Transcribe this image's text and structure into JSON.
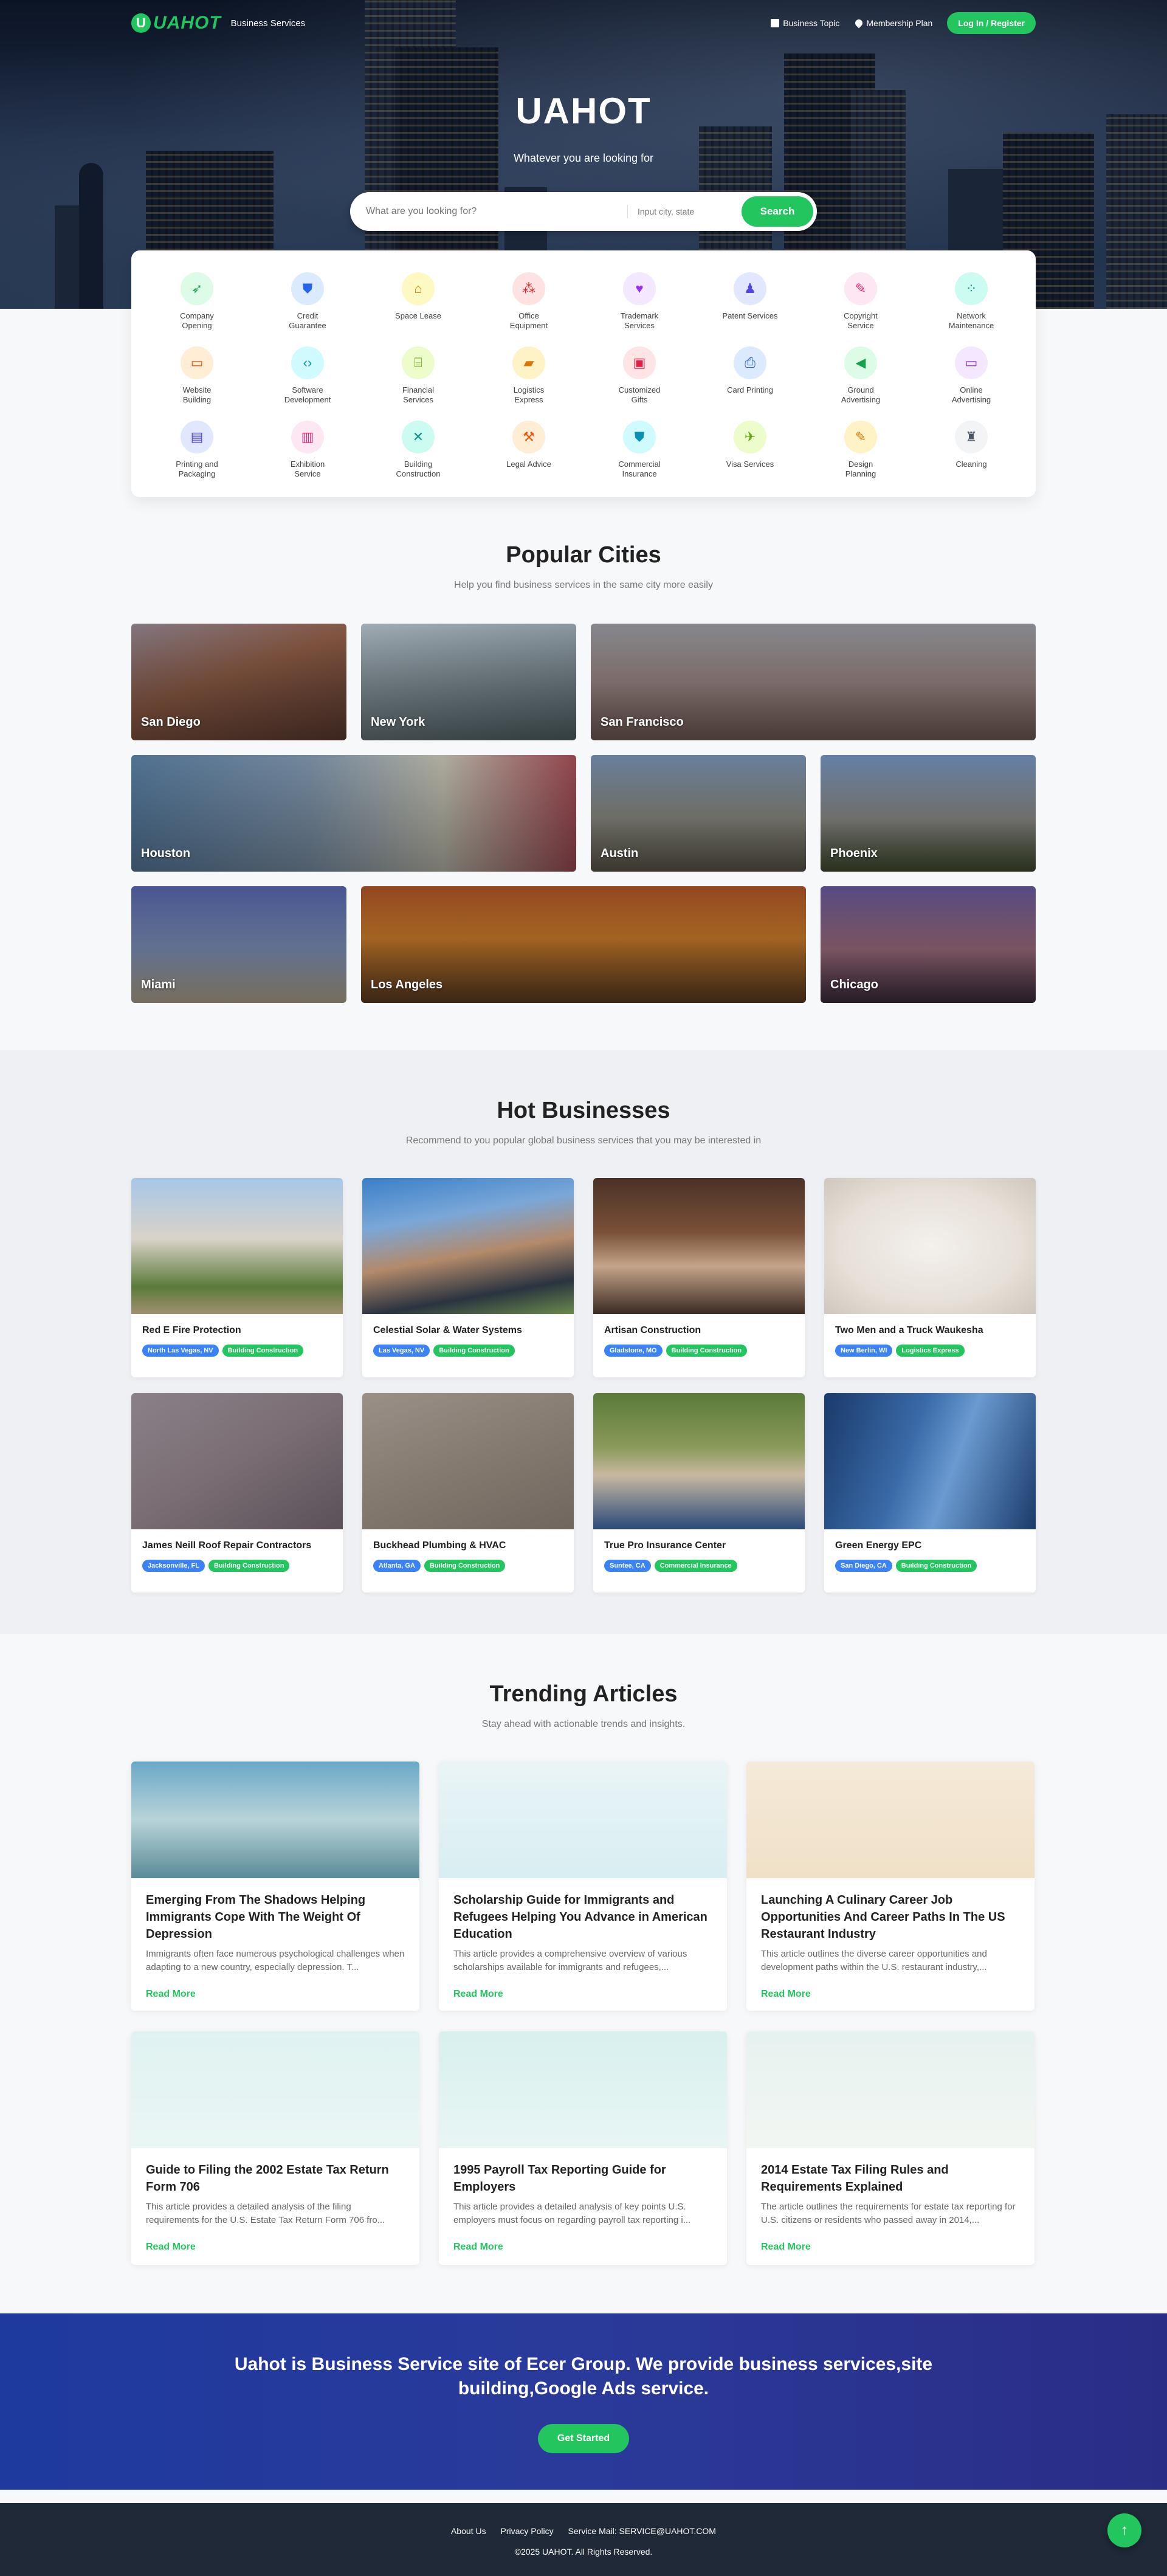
{
  "header": {
    "logo_letter": "U",
    "logo_text": "UAHOT",
    "logo_sub": "Business Services",
    "nav": [
      "Business Topic",
      "Membership Plan"
    ],
    "login": "Log In / Register"
  },
  "hero": {
    "title": "UAHOT",
    "subtitle": "Whatever you are looking for",
    "search_placeholder": "What are you looking for?",
    "location_placeholder": "Input city, state",
    "search_button": "Search"
  },
  "categories": [
    {
      "label": "Company Opening",
      "icon": "rocket-icon",
      "bg": "#dcfce7",
      "fg": "#16a34a",
      "glyph": "➶"
    },
    {
      "label": "Credit Guarantee",
      "icon": "shield-icon",
      "bg": "#dbeafe",
      "fg": "#2563eb",
      "glyph": "⛊"
    },
    {
      "label": "Space Lease",
      "icon": "home-icon",
      "bg": "#fef9c3",
      "fg": "#ca8a04",
      "glyph": "⌂"
    },
    {
      "label": "Office Equipment",
      "icon": "equipment-icon",
      "bg": "#fee2e2",
      "fg": "#dc2626",
      "glyph": "⁂"
    },
    {
      "label": "Trademark Services",
      "icon": "trademark-icon",
      "bg": "#f3e8ff",
      "fg": "#9333ea",
      "glyph": "♥"
    },
    {
      "label": "Patent Services",
      "icon": "patent-icon",
      "bg": "#e0e7ff",
      "fg": "#4f46e5",
      "glyph": "♟"
    },
    {
      "label": "Copyright Service",
      "icon": "copyright-icon",
      "bg": "#fce7f3",
      "fg": "#db2777",
      "glyph": "✎"
    },
    {
      "label": "Network Maintenance",
      "icon": "network-icon",
      "bg": "#ccfbf1",
      "fg": "#0d9488",
      "glyph": "⁘"
    },
    {
      "label": "Website Building",
      "icon": "window-icon",
      "bg": "#ffedd5",
      "fg": "#ea580c",
      "glyph": "▭"
    },
    {
      "label": "Software Development",
      "icon": "code-icon",
      "bg": "#cffafe",
      "fg": "#0891b2",
      "glyph": "‹›"
    },
    {
      "label": "Financial Services",
      "icon": "bank-icon",
      "bg": "#ecfccb",
      "fg": "#65a30d",
      "glyph": "⌸"
    },
    {
      "label": "Logistics Express",
      "icon": "truck-icon",
      "bg": "#fef3c7",
      "fg": "#d97706",
      "glyph": "▰"
    },
    {
      "label": "Customized Gifts",
      "icon": "gift-icon",
      "bg": "#ffe4e6",
      "fg": "#e11d48",
      "glyph": "▣"
    },
    {
      "label": "Card Printing",
      "icon": "printer-icon",
      "bg": "#dbeafe",
      "fg": "#2563eb",
      "glyph": "⎙"
    },
    {
      "label": "Ground Advertising",
      "icon": "megaphone-icon",
      "bg": "#dcfce7",
      "fg": "#16a34a",
      "glyph": "◀"
    },
    {
      "label": "Online Advertising",
      "icon": "monitor-icon",
      "bg": "#f3e8ff",
      "fg": "#9333ea",
      "glyph": "▭"
    },
    {
      "label": "Printing and Packaging",
      "icon": "box-icon",
      "bg": "#e0e7ff",
      "fg": "#4f46e5",
      "glyph": "▤"
    },
    {
      "label": "Exhibition Service",
      "icon": "store-icon",
      "bg": "#fce7f3",
      "fg": "#db2777",
      "glyph": "▥"
    },
    {
      "label": "Building Construction",
      "icon": "tools-icon",
      "bg": "#ccfbf1",
      "fg": "#0d9488",
      "glyph": "✕"
    },
    {
      "label": "Legal Advice",
      "icon": "gavel-icon",
      "bg": "#ffedd5",
      "fg": "#ea580c",
      "glyph": "⚒"
    },
    {
      "label": "Commercial Insurance",
      "icon": "shield-check-icon",
      "bg": "#cffafe",
      "fg": "#0891b2",
      "glyph": "⛊"
    },
    {
      "label": "Visa Services",
      "icon": "plane-icon",
      "bg": "#ecfccb",
      "fg": "#65a30d",
      "glyph": "✈"
    },
    {
      "label": "Design Planning",
      "icon": "ruler-icon",
      "bg": "#fef3c7",
      "fg": "#d97706",
      "glyph": "✎"
    },
    {
      "label": "Cleaning",
      "icon": "broom-icon",
      "bg": "#f3f4f6",
      "fg": "#4b5563",
      "glyph": "♜"
    }
  ],
  "cities": {
    "title": "Popular Cities",
    "subtitle": "Help you find business services in the same city more easily",
    "items": [
      {
        "name": "San Diego",
        "bg": "linear-gradient(160deg,#8a7d88 0%,#8b5a44 45%,#5a3a30 100%)"
      },
      {
        "name": "New York",
        "bg": "linear-gradient(170deg,#a9b6bf 0%,#7d8b92 50%,#4f5f63 100%)"
      },
      {
        "name": "San Francisco",
        "bg": "linear-gradient(180deg,#8d8f96 0%,#9a8684 50%,#6f5954 100%)"
      },
      {
        "name": "Houston",
        "bg": "linear-gradient(90deg,#55789a 0%,#7a8fa5 40%,#b8b6a8 70%,#9a4a52 100%)"
      },
      {
        "name": "Austin",
        "bg": "linear-gradient(180deg,#6f86a6 0%,#8a8a80 55%,#5a5448 100%)"
      },
      {
        "name": "Phoenix",
        "bg": "linear-gradient(180deg,#6b87b0 0%,#8d8c88 55%,#3e4a2c 100%)"
      },
      {
        "name": "Miami",
        "bg": "linear-gradient(180deg,#4b5a9a 0%,#7d8fb6 55%,#b4a890 100%)"
      },
      {
        "name": "Los Angeles",
        "bg": "linear-gradient(180deg,#9a4a22 0%,#c87a2a 45%,#5a3a20 100%)"
      },
      {
        "name": "Chicago",
        "bg": "linear-gradient(180deg,#5a4e8a 0%,#9a6a7a 55%,#3a2a3c 100%)"
      }
    ]
  },
  "hot": {
    "title": "Hot Businesses",
    "subtitle": "Recommend to you popular global business services that you may be interested in",
    "items": [
      {
        "name": "Red E Fire Protection",
        "location": "North Las Vegas, NV",
        "category": "Building Construction",
        "bg": "linear-gradient(180deg,#a7c7e8 0%,#d9d2c8 45%,#5b7a3a 80%,#a09070 100%)"
      },
      {
        "name": "Celestial Solar & Water Systems",
        "location": "Las Vegas, NV",
        "category": "Building Construction",
        "bg": "linear-gradient(170deg,#3a7fc8 0%,#7aa7d8 30%,#b38a6a 55%,#2a3340 80%,#6a8a4a 100%)"
      },
      {
        "name": "Artisan Construction",
        "location": "Gladstone, MO",
        "category": "Building Construction",
        "bg": "linear-gradient(180deg,#4a3226 0%,#7a5038 40%,#c4a48a 65%,#3a2a22 100%)"
      },
      {
        "name": "Two Men and a Truck Waukesha",
        "location": "New Berlin, WI",
        "category": "Logistics Express",
        "bg": "radial-gradient(ellipse at 50% 50%,#f4f0ec 0%,#e6e0d8 60%,#cfc7bd 100%)"
      },
      {
        "name": "James Neill Roof Repair Contractors",
        "location": "Jacksonville, FL",
        "category": "Building Construction",
        "bg": "linear-gradient(150deg,#8a8088 0%,#7a6e74 50%,#5a5058 100%)"
      },
      {
        "name": "Buckhead Plumbing & HVAC",
        "location": "Atlanta, GA",
        "category": "Building Construction",
        "bg": "linear-gradient(160deg,#9a9088 0%,#857a70 50%,#6f665e 100%)"
      },
      {
        "name": "True Pro Insurance Center",
        "location": "Suntee, CA",
        "category": "Commercial Insurance",
        "bg": "linear-gradient(180deg,#5a7a3a 0%,#8a9a5a 40%,#c8b8a0 60%,#2a4a7a 100%)"
      },
      {
        "name": "Green Energy EPC",
        "location": "San Diego, CA",
        "category": "Building Construction",
        "bg": "linear-gradient(110deg,#1a3a6a 0%,#3a6aa8 40%,#6a9ad0 60%,#1a3a6a 100%)"
      }
    ]
  },
  "articles": {
    "title": "Trending Articles",
    "subtitle": "Stay ahead with actionable trends and insights.",
    "read_more": "Read More",
    "items": [
      {
        "title": "Emerging From The Shadows Helping Immigrants Cope With The Weight Of Depression",
        "excerpt": "Immigrants often face numerous psychological challenges when adapting to a new country, especially depression. T...",
        "bg": "linear-gradient(180deg,#6aa8c8 0%,#b8d4d8 50%,#5a8a98 100%)"
      },
      {
        "title": "Scholarship Guide for Immigrants and Refugees Helping You Advance in American Education",
        "excerpt": "This article provides a comprehensive overview of various scholarships available for immigrants and refugees,...",
        "bg": "linear-gradient(180deg,#eaf4f6 0%,#d8eef2 100%)"
      },
      {
        "title": "Launching A Culinary Career Job Opportunities And Career Paths In The US Restaurant Industry",
        "excerpt": "This article outlines the diverse career opportunities and development paths within the U.S. restaurant industry,...",
        "bg": "linear-gradient(180deg,#f5ead8 0%,#f0e0c8 100%)"
      },
      {
        "title": "Guide to Filing the 2002 Estate Tax Return Form 706",
        "excerpt": "This article provides a detailed analysis of the filing requirements for the U.S. Estate Tax Return Form 706 fro...",
        "bg": "linear-gradient(180deg,#dff2f2 0%,#eaf6f4 100%)"
      },
      {
        "title": "1995 Payroll Tax Reporting Guide for Employers",
        "excerpt": "This article provides a detailed analysis of key points U.S. employers must focus on regarding payroll tax reporting i...",
        "bg": "linear-gradient(180deg,#d8f0ee 0%,#e8f6f4 100%)"
      },
      {
        "title": "2014 Estate Tax Filing Rules and Requirements Explained",
        "excerpt": "The article outlines the requirements for estate tax reporting for U.S. citizens or residents who passed away in 2014,...",
        "bg": "linear-gradient(180deg,#e6f2f0 0%,#f2f6f2 100%)"
      }
    ]
  },
  "cta": {
    "text": "Uahot is Business Service site of Ecer Group. We provide business services,site building,Google Ads service.",
    "button": "Get Started"
  },
  "footer": {
    "links": [
      "About Us",
      "Privacy Policy",
      "Service Mail: SERVICE@UAHOT.COM"
    ],
    "copyright": "©2025 UAHOT. All Rights Reserved."
  },
  "colors": {
    "accent": "#22c55e",
    "tag_blue": "#3b82f6",
    "cta_blue": "#1e3a9e",
    "footer": "#1f2937"
  }
}
